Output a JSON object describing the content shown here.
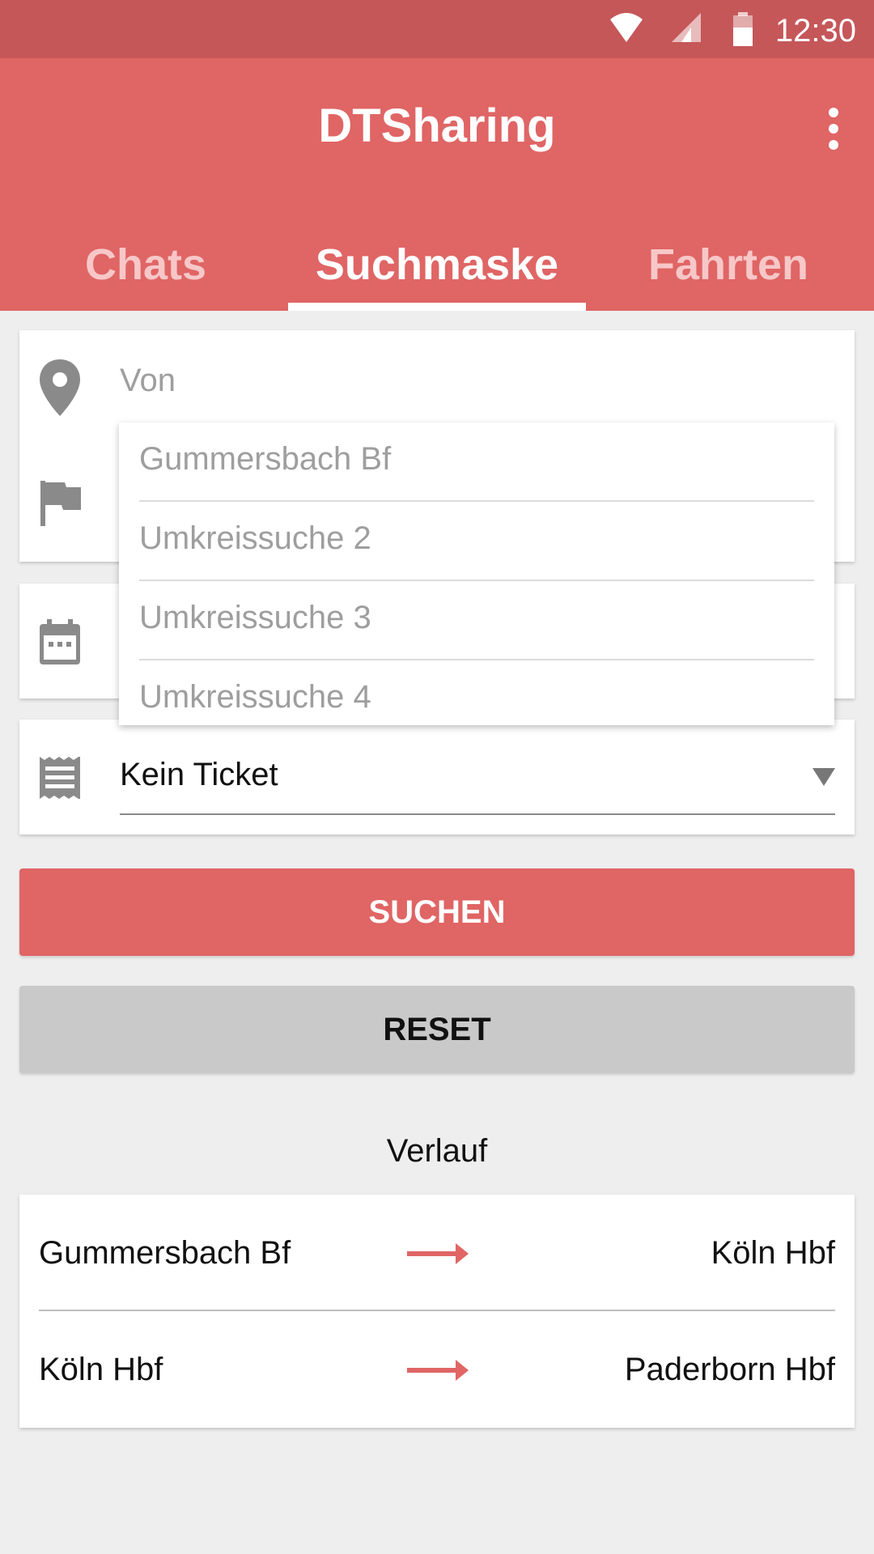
{
  "status_bar": {
    "time": "12:30",
    "icons": [
      "wifi-icon",
      "cell-signal-icon",
      "battery-icon"
    ]
  },
  "app_bar": {
    "title": "DTSharing",
    "overflow_icon": "more-vert-icon",
    "tabs": [
      {
        "label": "Chats",
        "active": false
      },
      {
        "label": "Suchmaske",
        "active": true
      },
      {
        "label": "Fahrten",
        "active": false
      }
    ]
  },
  "search_form": {
    "from_placeholder": "Von",
    "from_icon": "location-pin-icon",
    "to_icon": "flag-icon",
    "date_icon": "calendar-icon",
    "ticket_icon": "receipt-icon",
    "ticket_value": "Kein Ticket",
    "suggestions": [
      "Gummersbach Bf",
      "Umkreissuche 2",
      "Umkreissuche 3",
      "Umkreissuche 4"
    ]
  },
  "buttons": {
    "search_label": "SUCHEN",
    "reset_label": "RESET"
  },
  "history": {
    "title": "Verlauf",
    "items": [
      {
        "from": "Gummersbach Bf",
        "to": "Köln Hbf"
      },
      {
        "from": "Köln Hbf",
        "to": "Paderborn Hbf"
      }
    ]
  },
  "colors": {
    "primary": "#e06565",
    "status_bar": "#c55759",
    "background": "#eeeeee",
    "reset_button": "#c9c9c9"
  }
}
